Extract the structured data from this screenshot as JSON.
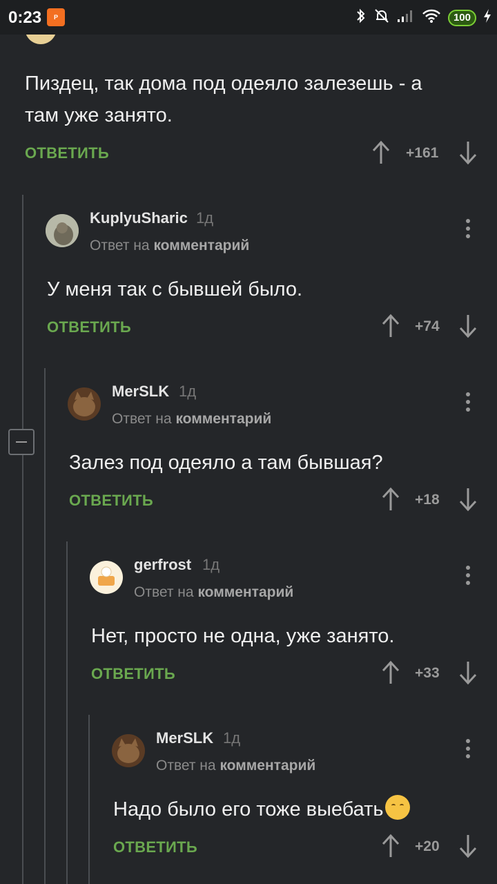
{
  "status_bar": {
    "time": "0:23",
    "app_icon": "pikabu-icon",
    "battery": "100"
  },
  "reply_label": "ОТВЕТИТЬ",
  "reply_to_prefix": "Ответ на",
  "reply_to_target": "комментарий",
  "colors": {
    "background": "#242629",
    "accent_green": "#6aa84f",
    "text": "#efefef"
  },
  "comments": [
    {
      "text_line1": "Пиздец, так дома под одеяло залезешь - а",
      "text_line2": "там уже занято.",
      "score": "+161"
    },
    {
      "author": "KuplyuSharic",
      "time": "1д",
      "text": "У меня так с бывшей было.",
      "score": "+74"
    },
    {
      "author": "MerSLK",
      "time": "1д",
      "text": "Залез под одеяло а там бывшая?",
      "score": "+18"
    },
    {
      "author": "gerfrost",
      "time": "1д",
      "text": "Нет, просто не одна, уже занято.",
      "score": "+33"
    },
    {
      "author": "MerSLK",
      "time": "1д",
      "text": "Надо было его тоже выебать",
      "emoji": "hugging-face-emoji",
      "score": "+20"
    }
  ]
}
